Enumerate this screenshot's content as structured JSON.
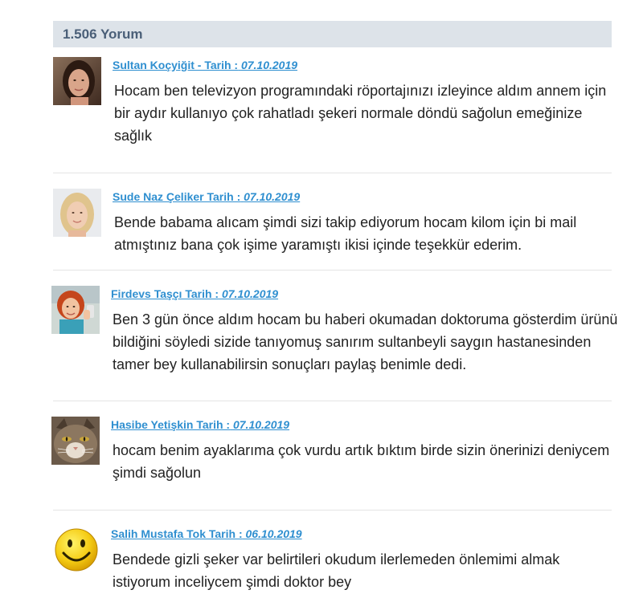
{
  "comments_header": {
    "count_label": "1.506 Yorum"
  },
  "comments": [
    {
      "author_label": "Sultan Koçyiğit - Tarih :",
      "date": "07.10.2019",
      "text": "Hocam ben televizyon programındaki röportajınızı izleyince aldım annem için bir aydır kullanıyo çok rahatladı şekeri normale döndü sağolun emeğinize sağlık",
      "avatar": "user-photo-woman-dark-hair"
    },
    {
      "author_label": "Sude Naz Çeliker Tarih :",
      "date": "07.10.2019",
      "text": "Bende babama alıcam şimdi sizi takip ediyorum hocam kilom için bi mail atmıştınız bana çok işime yaramıştı ikisi içinde teşekkür ederim.",
      "avatar": "user-photo-woman-blonde"
    },
    {
      "author_label": "Firdevs Taşçı Tarih :",
      "date": "07.10.2019",
      "text": "Ben 3 gün önce aldım hocam bu haberi okumadan doktoruma gösterdim ürünü bildiğini söyledi sizide tanıyomuş sanırım sultanbeyli saygın hastanesinden tamer bey kullanabilirsin sonuçları paylaş benimle dedi.",
      "avatar": "user-photo-woman-red-hair"
    },
    {
      "author_label": "Hasibe Yetişkin Tarih :",
      "date": "07.10.2019",
      "text": "hocam benim ayaklarıma çok vurdu artık bıktım birde sizin önerinizi deniycem şimdi sağolun",
      "avatar": "cat-photo-avatar"
    },
    {
      "author_label": "Salih Mustafa Tok Tarih :",
      "date": "06.10.2019",
      "text": "Bendede gizli şeker var belirtileri okudum ilerlemeden önlemimi almak istiyorum inceliycem şimdi doktor bey",
      "avatar": "smiley-face-avatar"
    }
  ]
}
